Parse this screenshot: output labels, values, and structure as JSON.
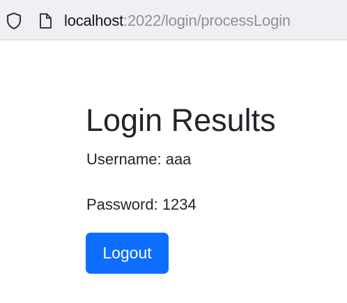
{
  "browser": {
    "url_host": "localhost",
    "url_rest": ":2022/login/processLogin",
    "icons": {
      "security": "shield-icon",
      "page": "page-icon"
    }
  },
  "page": {
    "title": "Login Results",
    "username_line": "Username: aaa",
    "password_line": "Password: 1234",
    "logout_label": "Logout",
    "accent_color": "#0d6efd"
  }
}
